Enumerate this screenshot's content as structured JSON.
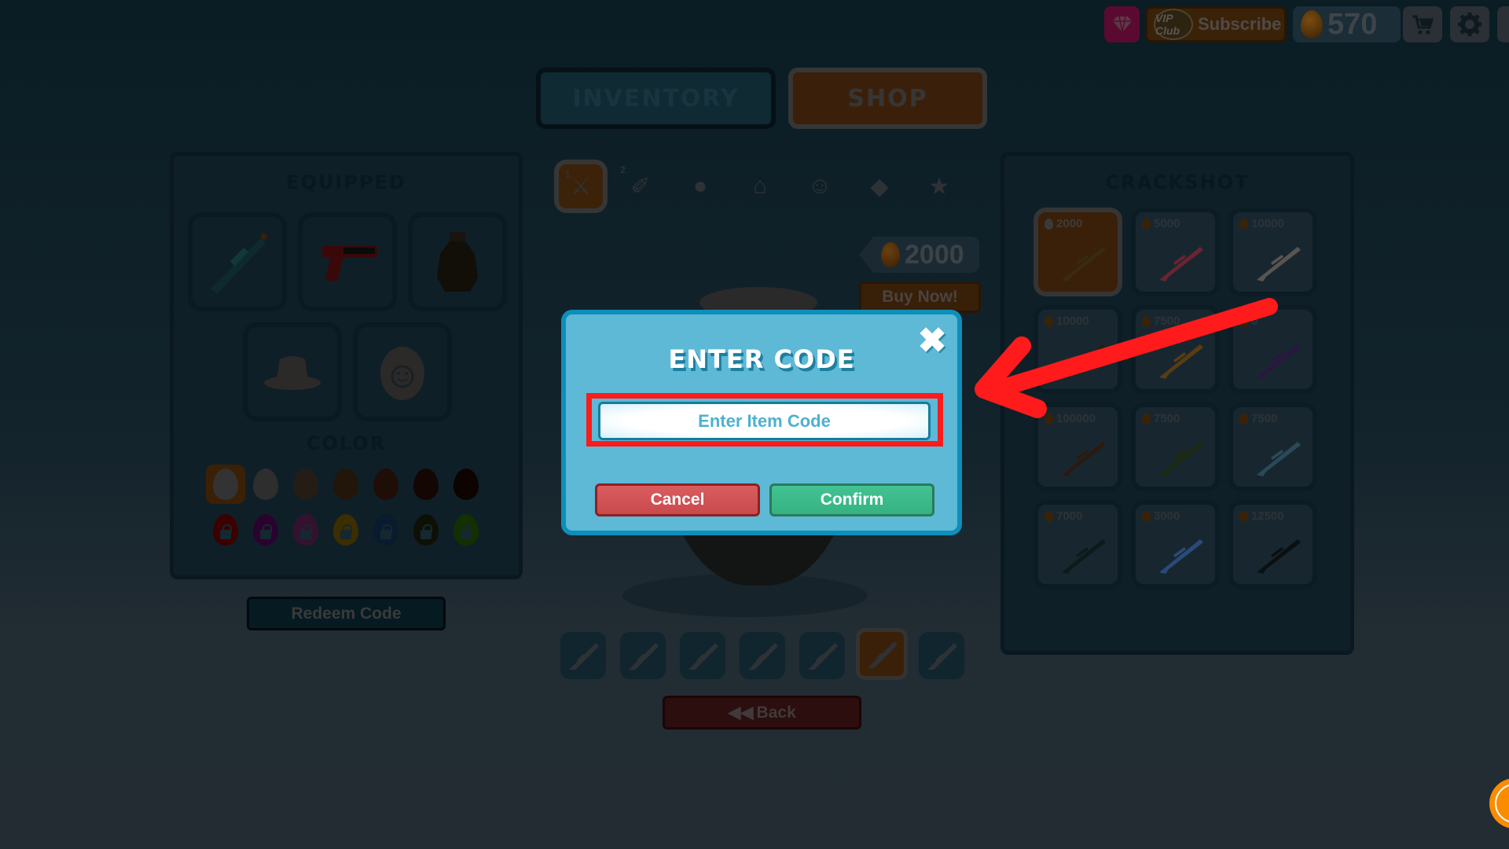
{
  "topbar": {
    "gem_icon": "diamond-icon",
    "vip_badge": "VIP Club",
    "subscribe_label": "Subscribe",
    "coins": "570",
    "coin_icon": "egg-coin-icon",
    "cart_icon": "cart-icon",
    "settings_icon": "gear-icon"
  },
  "main_tabs": [
    {
      "label": "INVENTORY",
      "active": false
    },
    {
      "label": "SHOP",
      "active": true
    }
  ],
  "equipped": {
    "title": "EQUIPPED",
    "slots": [
      "primary-weapon",
      "secondary-weapon",
      "grenade",
      "hat",
      "egg-skin"
    ],
    "color_title": "COLOR",
    "colors_unlocked": [
      "#e6e6e6",
      "#cfcfcf",
      "#a7845e",
      "#9a5e2b",
      "#8f3a1e",
      "#5a1a08",
      "#3a0f06"
    ],
    "colors_locked": [
      "#c40000",
      "#8a0a9a",
      "#b03aa0",
      "#c49a00",
      "#1e5a9a",
      "#2c3a10",
      "#3ca000"
    ],
    "selected_color_index": 0,
    "redeem_label": "Redeem Code"
  },
  "categories": [
    {
      "icon": "primary-weapon-icon",
      "badge": "1",
      "active": true
    },
    {
      "icon": "pistol-icon",
      "badge": "2",
      "active": false
    },
    {
      "icon": "grenade-icon",
      "active": false
    },
    {
      "icon": "hat-icon",
      "active": false
    },
    {
      "icon": "egg-face-icon",
      "active": false
    },
    {
      "icon": "diamond-icon",
      "active": false
    },
    {
      "icon": "star-icon",
      "active": false
    }
  ],
  "preview": {
    "price": "2000",
    "buy_label": "Buy Now!"
  },
  "weapon_bar": {
    "slots": [
      "assault-rifle",
      "shotgun",
      "scoped-rifle",
      "rpg",
      "smg",
      "sniper",
      "trihard"
    ],
    "active_index": 5
  },
  "back_label": "Back",
  "shop": {
    "title": "CRACKSHOT",
    "items": [
      {
        "price": "2000",
        "selected": true,
        "gun_color": "#3a2a10"
      },
      {
        "price": "5000",
        "selected": false,
        "gun_color": "#6a2430"
      },
      {
        "price": "10000",
        "selected": false,
        "gun_color": "#5a5450"
      },
      {
        "price": "10000",
        "selected": false,
        "gun_color": "#2a1a10"
      },
      {
        "price": "7500",
        "selected": false,
        "gun_color": "#5a3c10"
      },
      {
        "price": "0",
        "selected": false,
        "gun_color": "#2a1640"
      },
      {
        "price": "100000",
        "selected": false,
        "gun_color": "#2a1a10"
      },
      {
        "price": "7500",
        "selected": false,
        "gun_color": "#1c2a10"
      },
      {
        "price": "7500",
        "selected": false,
        "gun_color": "#2a4a5a"
      },
      {
        "price": "7000",
        "selected": false,
        "gun_color": "#0c1a1a"
      },
      {
        "price": "3000",
        "selected": false,
        "gun_color": "#2a4a7a"
      },
      {
        "price": "12500",
        "selected": false,
        "gun_color": "#0a0f12"
      }
    ]
  },
  "dialog": {
    "title": "ENTER CODE",
    "input_value": "",
    "input_placeholder": "Enter Item Code",
    "cancel_label": "Cancel",
    "confirm_label": "Confirm",
    "close_icon": "close-icon",
    "highlight_color": "#ff1b1b"
  },
  "annotation": {
    "arrow_color": "#ff1b1b",
    "points_to": "code-input"
  },
  "support_icon": "support-chat-icon"
}
